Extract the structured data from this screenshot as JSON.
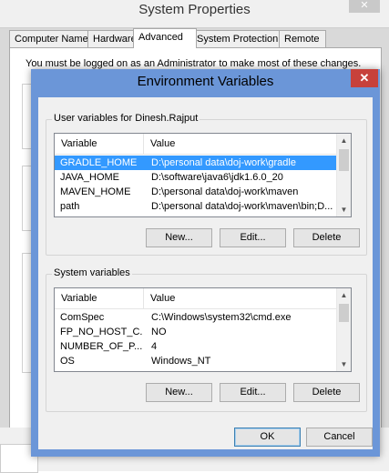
{
  "system_properties": {
    "title": "System Properties",
    "tabs": [
      "Computer Name",
      "Hardware",
      "Advanced",
      "System Protection",
      "Remote"
    ],
    "active_tab": "Advanced",
    "notice": "You must be logged on as an Administrator to make most of these changes."
  },
  "env_dialog": {
    "title": "Environment Variables",
    "close_glyph": "✕",
    "user_section": {
      "label": "User variables for Dinesh.Rajput",
      "columns": [
        "Variable",
        "Value"
      ],
      "rows": [
        {
          "variable": "GRADLE_HOME",
          "value": "D:\\personal data\\doj-work\\gradle"
        },
        {
          "variable": "JAVA_HOME",
          "value": "D:\\software\\java6\\jdk1.6.0_20"
        },
        {
          "variable": "MAVEN_HOME",
          "value": "D:\\personal data\\doj-work\\maven"
        },
        {
          "variable": "path",
          "value": "D:\\personal data\\doj-work\\maven\\bin;D..."
        }
      ],
      "selected_row": 0,
      "buttons": {
        "new": "New...",
        "edit": "Edit...",
        "delete": "Delete"
      }
    },
    "system_section": {
      "label": "System variables",
      "columns": [
        "Variable",
        "Value"
      ],
      "rows": [
        {
          "variable": "ComSpec",
          "value": "C:\\Windows\\system32\\cmd.exe"
        },
        {
          "variable": "FP_NO_HOST_C...",
          "value": "NO"
        },
        {
          "variable": "NUMBER_OF_P...",
          "value": "4"
        },
        {
          "variable": "OS",
          "value": "Windows_NT"
        }
      ],
      "buttons": {
        "new": "New...",
        "edit": "Edit...",
        "delete": "Delete"
      }
    },
    "footer_buttons": {
      "ok": "OK",
      "cancel": "Cancel"
    }
  }
}
